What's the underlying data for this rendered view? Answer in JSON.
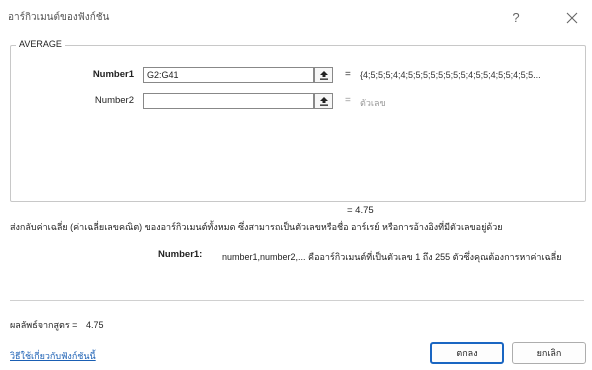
{
  "dialog": {
    "title": "อาร์กิวเมนต์ของฟังก์ชัน",
    "help_label": "?",
    "group_label": "AVERAGE"
  },
  "arguments": [
    {
      "label": "Number1",
      "value": "G2:G41",
      "result": "{4;5;5;5;4;4;5;5;5;5;5;5;5;5;4;5;5;4;5;5;4;5;5...",
      "result_color": "#333333"
    },
    {
      "label": "Number2",
      "value": "",
      "result": "ตัวเลข",
      "result_color": "#999999"
    }
  ],
  "equals_sign": "=",
  "result_line": "=   4.75",
  "description": "ส่งกลับค่าเฉลี่ย (ค่าเฉลี่ยเลขคณิต) ของอาร์กิวเมนต์ทั้งหมด ซึ่งสามารถเป็นตัวเลขหรือชื่อ อาร์เรย์ หรือการอ้างอิงที่มีตัวเลขอยู่ด้วย",
  "arg_help": {
    "name": "Number1:",
    "text": "number1,number2,... คืออาร์กิวเมนต์ที่เป็นตัวเลข 1 ถึง 255 ตัวซึ่งคุณต้องการหาค่าเฉลี่ย"
  },
  "formula_result": {
    "label": "ผลลัพธ์จากสูตร =",
    "value": "4.75"
  },
  "help_link": "วิธีใช้เกี่ยวกับฟังก์ชันนี้",
  "buttons": {
    "ok": "ตกลง",
    "cancel": "ยกเลิก"
  },
  "colors": {
    "accent": "#1a66c2",
    "link": "#1a5fb4"
  }
}
